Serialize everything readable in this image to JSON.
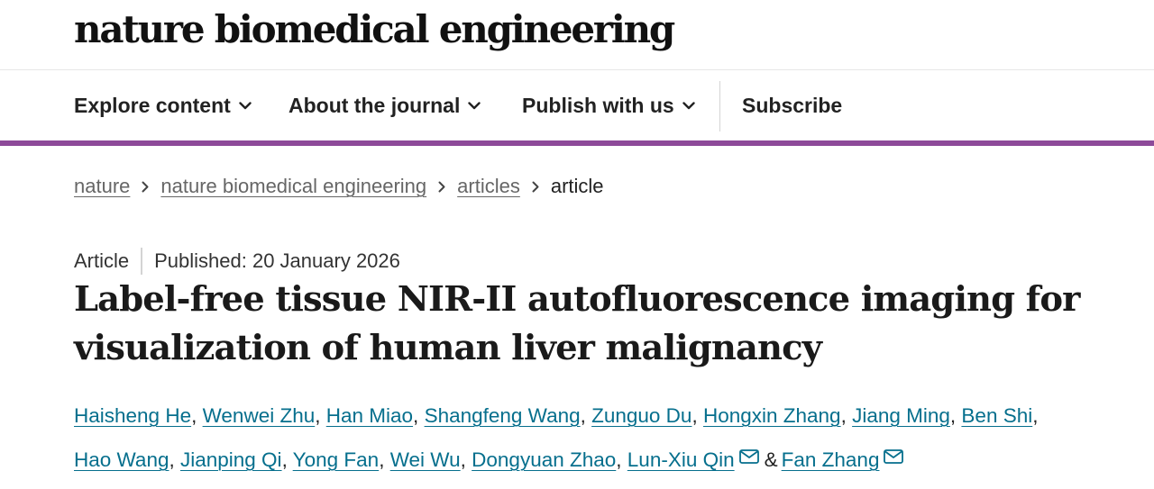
{
  "journal": {
    "title": "nature biomedical engineering"
  },
  "nav": {
    "items": [
      {
        "label": "Explore content",
        "icon": "chevron-down-icon"
      },
      {
        "label": "About the journal",
        "icon": "chevron-down-icon"
      },
      {
        "label": "Publish with us",
        "icon": "chevron-down-icon"
      }
    ],
    "subscribe": "Subscribe",
    "accent_color": "#8d4a99"
  },
  "breadcrumb": {
    "items": [
      "nature",
      "nature biomedical engineering",
      "articles"
    ],
    "current": "article"
  },
  "article": {
    "type": "Article",
    "published": "Published: 20 January 2026",
    "title": "Label-free tissue NIR-II autofluorescence imaging for visualization of human liver malignancy",
    "authors": [
      "Haisheng He",
      "Wenwei Zhu",
      "Han Miao",
      "Shangfeng Wang",
      "Zunguo Du",
      "Hongxin Zhang",
      "Jiang Ming",
      "Ben Shi",
      "Hao Wang",
      "Jianping Qi",
      "Yong Fan",
      "Wei Wu",
      "Dongyuan Zhao",
      "Lun-Xiu Qin",
      "Fan Zhang"
    ],
    "author_link_color": "#066f8d",
    "corresponding_icon": "mail-icon"
  }
}
